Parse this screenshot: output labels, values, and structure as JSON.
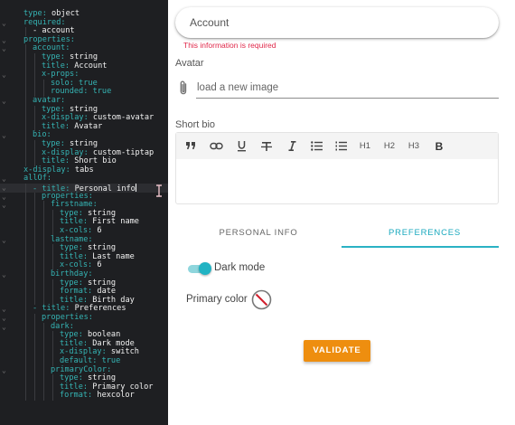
{
  "editor": {
    "lines": [
      {
        "indent": 0,
        "key": "type",
        "value": "object",
        "fold": false
      },
      {
        "indent": 0,
        "key": "required",
        "value": "",
        "fold": true
      },
      {
        "indent": 1,
        "key": "",
        "value": "- account",
        "fold": false
      },
      {
        "indent": 0,
        "key": "properties",
        "value": "",
        "fold": true
      },
      {
        "indent": 1,
        "key": "account",
        "value": "",
        "fold": true
      },
      {
        "indent": 2,
        "key": "type",
        "value": "string",
        "fold": false
      },
      {
        "indent": 2,
        "key": "title",
        "value": "Account",
        "fold": false
      },
      {
        "indent": 2,
        "key": "x-props",
        "value": "",
        "fold": true
      },
      {
        "indent": 3,
        "key": "solo",
        "value": "true",
        "fold": false
      },
      {
        "indent": 3,
        "key": "rounded",
        "value": "true",
        "fold": false
      },
      {
        "indent": 1,
        "key": "avatar",
        "value": "",
        "fold": true
      },
      {
        "indent": 2,
        "key": "type",
        "value": "string",
        "fold": false
      },
      {
        "indent": 2,
        "key": "x-display",
        "value": "custom-avatar",
        "fold": false
      },
      {
        "indent": 2,
        "key": "title",
        "value": "Avatar",
        "fold": false
      },
      {
        "indent": 1,
        "key": "bio",
        "value": "",
        "fold": true
      },
      {
        "indent": 2,
        "key": "type",
        "value": "string",
        "fold": false
      },
      {
        "indent": 2,
        "key": "x-display",
        "value": "custom-tiptap",
        "fold": false
      },
      {
        "indent": 2,
        "key": "title",
        "value": "Short bio",
        "fold": false
      },
      {
        "indent": 0,
        "key": "x-display",
        "value": "tabs",
        "fold": false
      },
      {
        "indent": 0,
        "key": "allOf",
        "value": "",
        "fold": true
      },
      {
        "indent": 1,
        "key": "- title",
        "value": "Personal info",
        "fold": true,
        "active": true
      },
      {
        "indent": 2,
        "key": "properties",
        "value": "",
        "fold": true
      },
      {
        "indent": 3,
        "key": "firstname",
        "value": "",
        "fold": true
      },
      {
        "indent": 4,
        "key": "type",
        "value": "string",
        "fold": false
      },
      {
        "indent": 4,
        "key": "title",
        "value": "First name",
        "fold": false
      },
      {
        "indent": 4,
        "key": "x-cols",
        "value": "6",
        "fold": false
      },
      {
        "indent": 3,
        "key": "lastname",
        "value": "",
        "fold": true
      },
      {
        "indent": 4,
        "key": "type",
        "value": "string",
        "fold": false
      },
      {
        "indent": 4,
        "key": "title",
        "value": "Last name",
        "fold": false
      },
      {
        "indent": 4,
        "key": "x-cols",
        "value": "6",
        "fold": false
      },
      {
        "indent": 3,
        "key": "birthday",
        "value": "",
        "fold": true
      },
      {
        "indent": 4,
        "key": "type",
        "value": "string",
        "fold": false
      },
      {
        "indent": 4,
        "key": "format",
        "value": "date",
        "fold": false
      },
      {
        "indent": 4,
        "key": "title",
        "value": "Birth day",
        "fold": false
      },
      {
        "indent": 1,
        "key": "- title",
        "value": "Preferences",
        "fold": true
      },
      {
        "indent": 2,
        "key": "properties",
        "value": "",
        "fold": true
      },
      {
        "indent": 3,
        "key": "dark",
        "value": "",
        "fold": true
      },
      {
        "indent": 4,
        "key": "type",
        "value": "boolean",
        "fold": false
      },
      {
        "indent": 4,
        "key": "title",
        "value": "Dark mode",
        "fold": false
      },
      {
        "indent": 4,
        "key": "x-display",
        "value": "switch",
        "fold": false
      },
      {
        "indent": 4,
        "key": "default",
        "value": "true",
        "fold": false
      },
      {
        "indent": 3,
        "key": "primaryColor",
        "value": "",
        "fold": true
      },
      {
        "indent": 4,
        "key": "type",
        "value": "string",
        "fold": false
      },
      {
        "indent": 4,
        "key": "title",
        "value": "Primary color",
        "fold": false
      },
      {
        "indent": 4,
        "key": "format",
        "value": "hexcolor",
        "fold": false
      }
    ]
  },
  "form": {
    "account": {
      "label": "Account",
      "error": "This information is required"
    },
    "avatar": {
      "label": "Avatar",
      "placeholder": "load a new image",
      "icon": "paperclip-icon"
    },
    "bio": {
      "label": "Short bio",
      "toolbar": [
        {
          "name": "blockquote-icon",
          "label": ""
        },
        {
          "name": "link-icon",
          "label": ""
        },
        {
          "name": "underline-icon",
          "label": ""
        },
        {
          "name": "strikethrough-icon",
          "label": ""
        },
        {
          "name": "italic-icon",
          "label": ""
        },
        {
          "name": "bullet-list-icon",
          "label": ""
        },
        {
          "name": "ordered-list-icon",
          "label": ""
        },
        {
          "name": "heading-1-button",
          "label": "H1"
        },
        {
          "name": "heading-2-button",
          "label": "H2"
        },
        {
          "name": "heading-3-button",
          "label": "H3"
        },
        {
          "name": "bold-icon",
          "label": "B"
        }
      ]
    },
    "tabs": [
      {
        "label": "PERSONAL INFO",
        "active": false
      },
      {
        "label": "PREFERENCES",
        "active": true
      }
    ],
    "dark_mode": {
      "label": "Dark mode",
      "on": true
    },
    "primary_color": {
      "label": "Primary color",
      "value": "none"
    },
    "validate_label": "VALIDATE"
  },
  "colors": {
    "accent": "#21b3c3",
    "button": "#ee8e0f",
    "error": "#e0284a",
    "editor_key": "#35b4b4",
    "editor_bg": "#1e1f22"
  }
}
